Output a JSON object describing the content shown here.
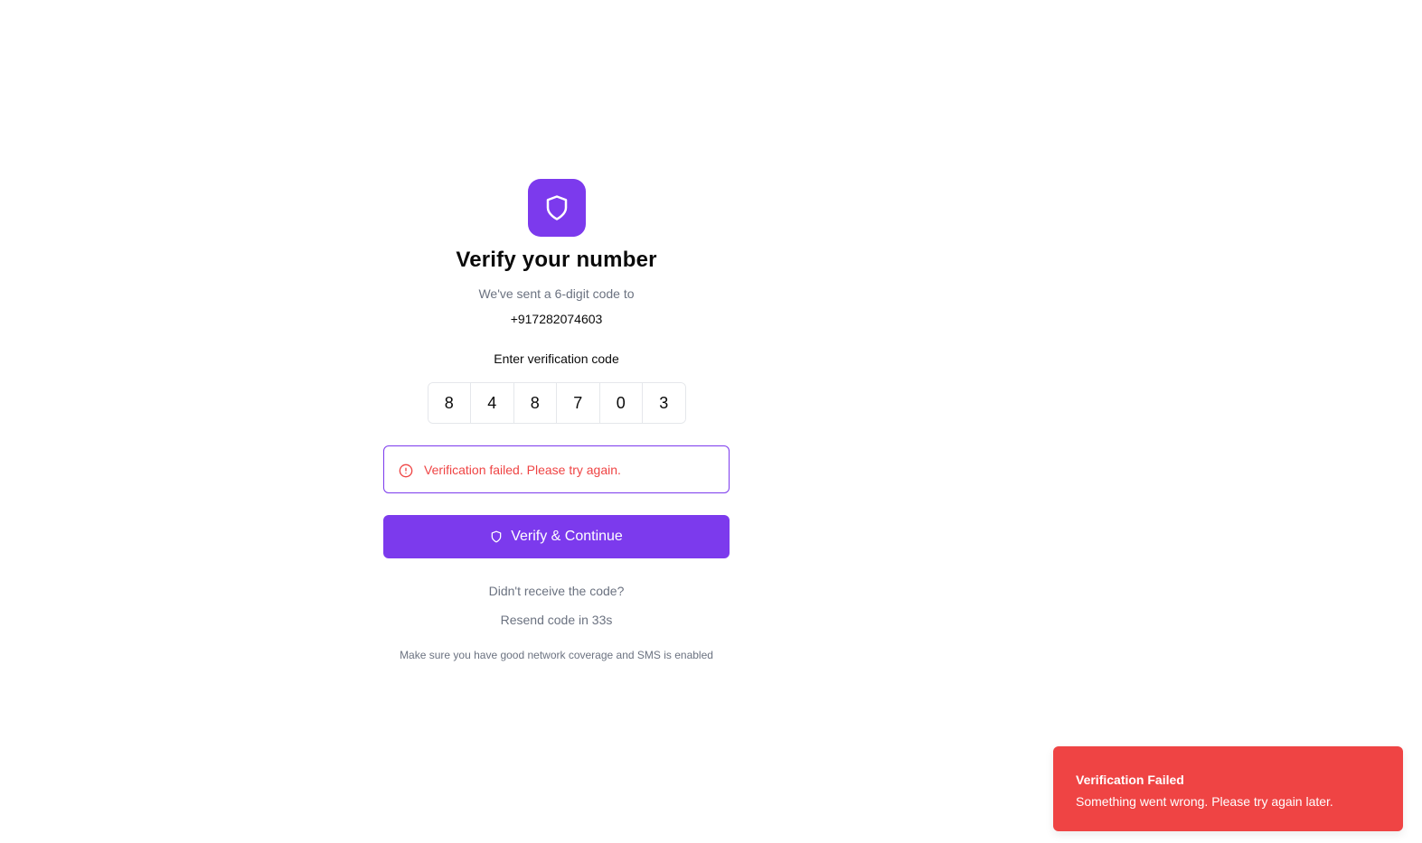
{
  "header": {
    "title": "Verify your number",
    "subtitle": "We've sent a 6-digit code to",
    "phone": "+917282074603",
    "logo_icon": "shield-icon"
  },
  "form": {
    "code_label": "Enter verification code",
    "code_digits": [
      "8",
      "4",
      "8",
      "7",
      "0",
      "3"
    ],
    "error_message": "Verification failed. Please try again.",
    "error_icon": "alert-circle-icon",
    "submit_label": "Verify & Continue",
    "submit_icon": "shield-icon"
  },
  "resend": {
    "question": "Didn't receive the code?",
    "countdown_text": "Resend code in 33s"
  },
  "hint": "Make sure you have good network coverage and SMS is enabled",
  "toast": {
    "title": "Verification Failed",
    "description": "Something went wrong. Please try again later."
  },
  "colors": {
    "accent": "#7c3aed",
    "error": "#ef4444",
    "muted_text": "#6b7280",
    "border": "#e5e7eb"
  }
}
